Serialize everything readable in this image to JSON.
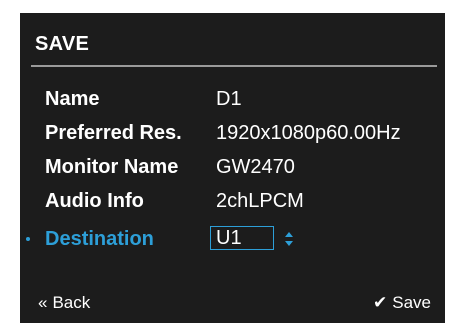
{
  "dialog": {
    "title": "SAVE"
  },
  "fields": [
    {
      "label": "Name",
      "value": "D1"
    },
    {
      "label": "Preferred Res.",
      "value": "1920x1080p60.00Hz"
    },
    {
      "label": "Monitor Name",
      "value": "GW2470"
    },
    {
      "label": "Audio Info",
      "value": "2chLPCM"
    }
  ],
  "destination": {
    "label": "Destination",
    "value": "U1",
    "stepper_icon": "up-down-arrows-icon"
  },
  "footer": {
    "back_icon": "double-chevron-left-icon",
    "back_label": "Back",
    "save_icon": "check-icon",
    "save_label": "Save"
  },
  "colors": {
    "panel_bg": "#1c1c1c",
    "accent": "#2d9fd8",
    "text": "#ffffff",
    "divider": "#9a9a9a"
  }
}
